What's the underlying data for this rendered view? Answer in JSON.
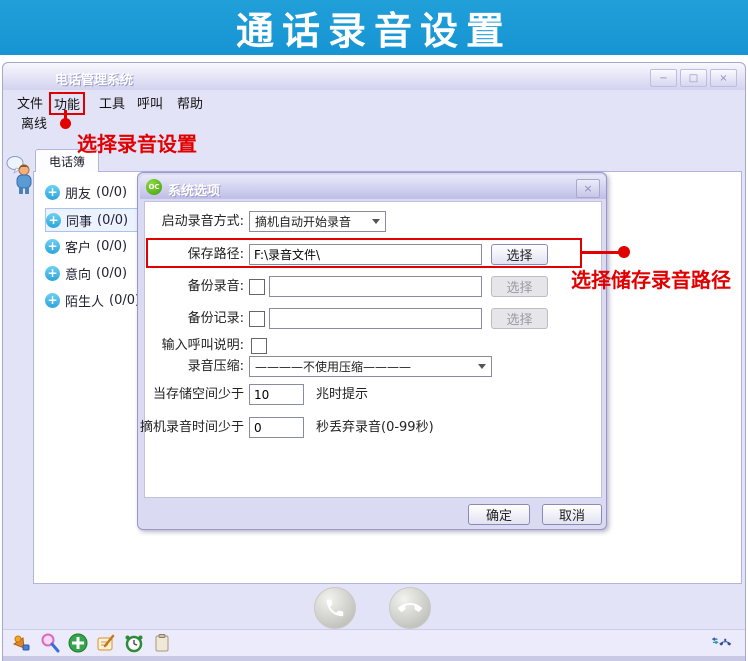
{
  "banner": {
    "title": "通话录音设置"
  },
  "window": {
    "title": "电话管理系统",
    "controls": {
      "minimize": "−",
      "maximize": "□",
      "close": "×"
    },
    "menu": [
      {
        "label": "文件"
      },
      {
        "label": "功能",
        "highlighted": true
      },
      {
        "label": "工具"
      },
      {
        "label": "呼叫"
      },
      {
        "label": "帮助"
      }
    ],
    "offline_item": "离线",
    "phonebook_tab": "电话簿"
  },
  "sidebar": {
    "groups": [
      {
        "label": "朋友",
        "count": "(0/0)"
      },
      {
        "label": "同事",
        "count": "(0/0)",
        "selected": true
      },
      {
        "label": "客户",
        "count": "(0/0)"
      },
      {
        "label": "意向",
        "count": "(0/0)"
      },
      {
        "label": "陌生人",
        "count": "(0/0)"
      }
    ]
  },
  "icons": {
    "plus": "+"
  },
  "annotations": {
    "color": "#e10000",
    "menu_callout": "选择录音设置",
    "path_callout": "选择储存录音路径"
  },
  "dialog": {
    "title": "系统选项",
    "icon_text": "OC",
    "close": "×",
    "rows": {
      "start_mode": {
        "label": "启动录音方式:",
        "value": "摘机自动开始录音"
      },
      "save_path": {
        "label": "保存路径:",
        "value": "F:\\录音文件\\",
        "button": "选择"
      },
      "backup_recording": {
        "label": "备份录音:",
        "value": "",
        "checked": false,
        "button": "选择"
      },
      "backup_log": {
        "label": "备份记录:",
        "value": "",
        "checked": false,
        "button": "选择"
      },
      "call_note": {
        "label": "输入呼叫说明:",
        "checked": false
      },
      "compression": {
        "label": "录音压缩:",
        "value": "————不使用压缩————"
      },
      "space_warning": {
        "label": "当存储空间少于",
        "value": "10",
        "suffix": "兆时提示"
      },
      "discard_time": {
        "label": "摘机录音时间少于",
        "value": "0",
        "suffix": "秒丢弃录音(0-99秒)"
      }
    },
    "buttons": {
      "ok": "确定",
      "cancel": "取消"
    }
  }
}
